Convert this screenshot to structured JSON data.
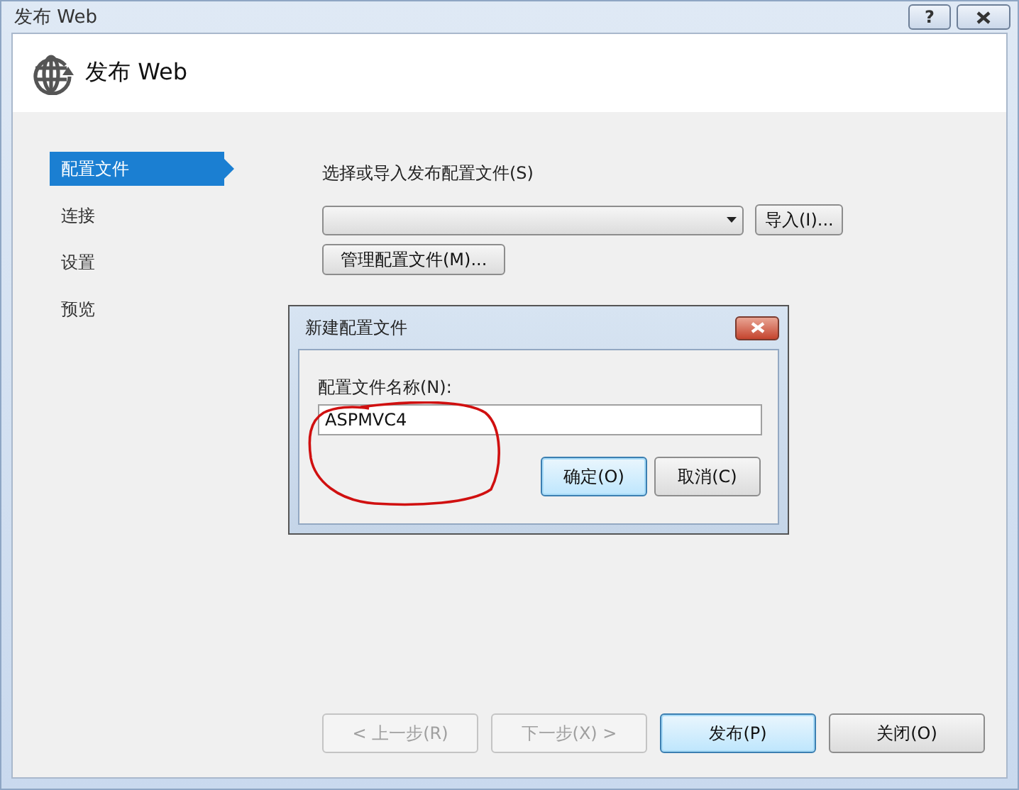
{
  "window": {
    "title": "发布 Web",
    "help_button": "?"
  },
  "header": {
    "title": "发布 Web"
  },
  "sidebar": {
    "items": [
      {
        "label": "配置文件",
        "selected": true
      },
      {
        "label": "连接",
        "selected": false
      },
      {
        "label": "设置",
        "selected": false
      },
      {
        "label": "预览",
        "selected": false
      }
    ]
  },
  "profile": {
    "label": "选择或导入发布配置文件(S)",
    "import_button": "导入(I)...",
    "manage_button": "管理配置文件(M)..."
  },
  "dialog": {
    "title": "新建配置文件",
    "field_label": "配置文件名称(N):",
    "field_value": "ASPMVC4",
    "annotated": true,
    "buttons": [
      {
        "label": "确定(O)",
        "default": true
      },
      {
        "label": "取消(C)",
        "default": false
      }
    ]
  },
  "footer": {
    "buttons": [
      {
        "label": "< 上一步(R)",
        "disabled": true,
        "default": false
      },
      {
        "label": "下一步(X) >",
        "disabled": true,
        "default": false
      },
      {
        "label": "发布(P)",
        "disabled": false,
        "default": true
      },
      {
        "label": "关闭(O)",
        "disabled": false,
        "default": false
      }
    ]
  }
}
